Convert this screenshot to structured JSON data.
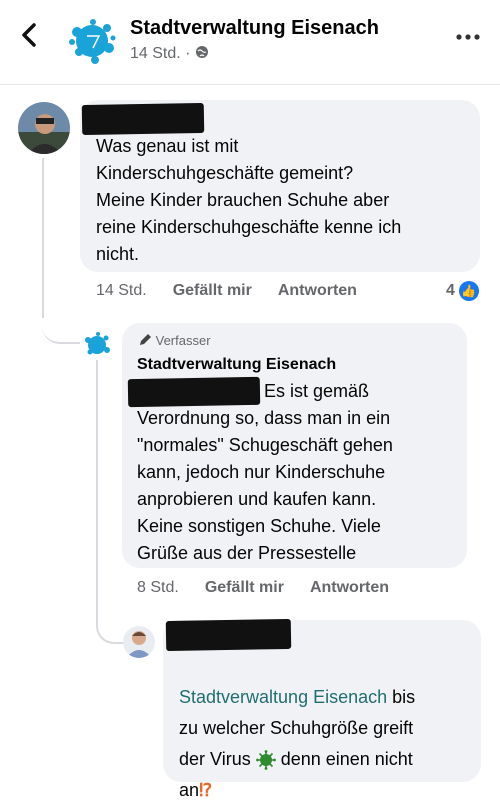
{
  "header": {
    "back_icon": "chevron-left-icon",
    "page_name": "Stadtverwaltung Eisenach",
    "meta": "14 Std. · ",
    "privacy_icon": "globe-icon",
    "more_icon": "more-horizontal-icon"
  },
  "comments": [
    {
      "author_redacted": true,
      "text": "Was genau ist mit\nKinderschuhgeschäfte gemeint?\nMeine Kinder brauchen Schuhe aber\nreine Kinderschuhgeschäfte kenne ich\nnicht.",
      "time": "14 Std.",
      "like_label": "Gefällt mir",
      "reply_label": "Antworten",
      "reaction_count": "4"
    },
    {
      "badge": "Verfasser",
      "author": "Stadtverwaltung Eisenach",
      "text_first_line": "Es ist gemäß",
      "text_rest": "Verordnung so, dass man in ein\n\"normales\" Schugeschäft gehen\nkann, jedoch nur Kinderschuhe\nanprobieren und kaufen kann.\nKeine sonstigen Schuhe. Viele\nGrüße aus der Pressestelle",
      "time": "8 Std.",
      "like_label": "Gefällt mir",
      "reply_label": "Antworten"
    },
    {
      "author_redacted": true,
      "mention": "Stadtverwaltung Eisenach",
      "text_after_mention": " bis",
      "line2": "zu welcher Schuhgröße greift",
      "line3_before": "der Virus ",
      "line3_after": " denn einen nicht",
      "line4": "an",
      "line4_punct": "⁉"
    }
  ],
  "colors": {
    "brand_splash": "#1aa3d9",
    "bubble_bg": "#f0f2f5",
    "mention": "#216e70",
    "like_blue": "#1877f2",
    "virus_green": "#2e8b2e"
  }
}
